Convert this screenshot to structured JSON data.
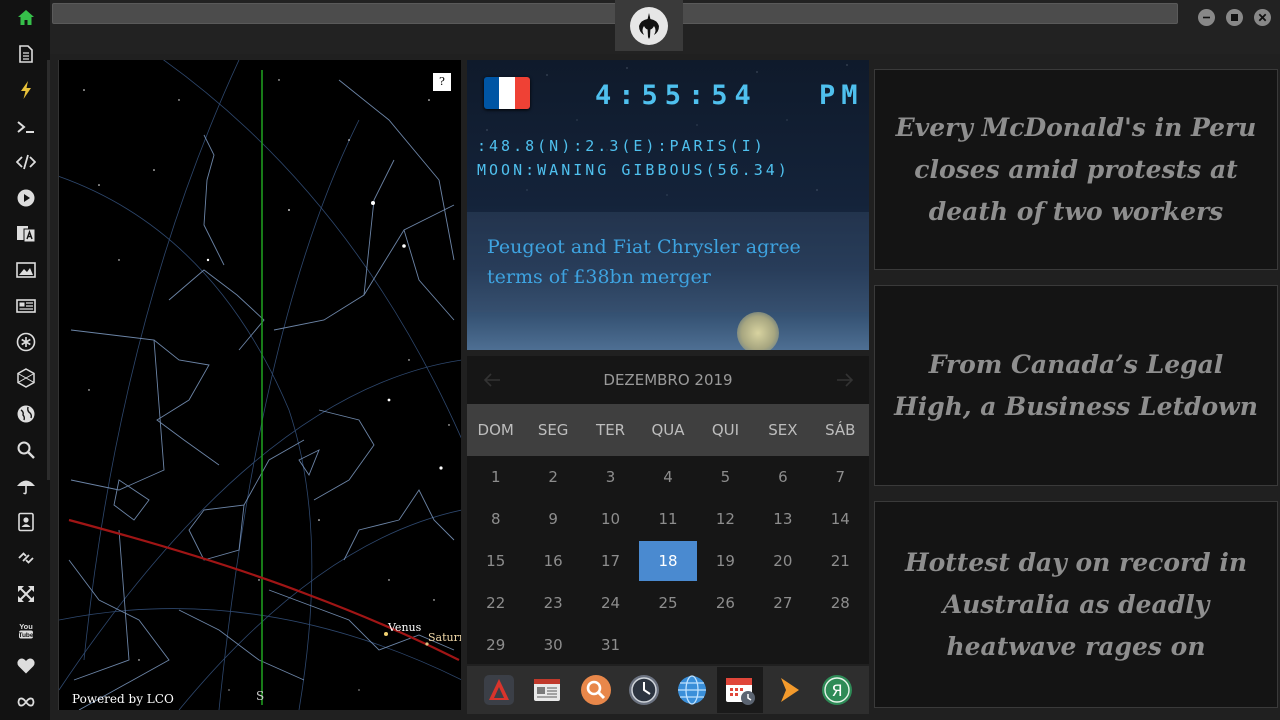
{
  "sidebar": {
    "items": [
      {
        "icon": "home-icon",
        "color": "#36c04a"
      },
      {
        "icon": "document-icon"
      },
      {
        "icon": "lightning-icon",
        "color": "#e8c23a"
      },
      {
        "icon": "terminal-icon"
      },
      {
        "icon": "code-icon"
      },
      {
        "icon": "play-icon"
      },
      {
        "icon": "translate-icon"
      },
      {
        "icon": "image-icon"
      },
      {
        "icon": "newspaper-icon"
      },
      {
        "icon": "asterisk-icon"
      },
      {
        "icon": "hexagon-icon"
      },
      {
        "icon": "globe-icon"
      },
      {
        "icon": "search-icon"
      },
      {
        "icon": "umbrella-icon"
      },
      {
        "icon": "contacts-icon"
      },
      {
        "icon": "link-icon"
      },
      {
        "icon": "expand-icon"
      },
      {
        "icon": "youtube-icon"
      },
      {
        "icon": "heart-icon"
      },
      {
        "icon": "infinity-icon"
      }
    ]
  },
  "window": {
    "logo": "rebel-alliance-icon",
    "buttons": [
      "minimize-icon",
      "maximize-icon",
      "close-icon"
    ]
  },
  "skymap": {
    "help_label": "?",
    "powered_by": "Powered by LCO",
    "planets": [
      "Venus",
      "Saturn"
    ],
    "compass_label": "S"
  },
  "clock": {
    "flag_colors": [
      "#0055a4",
      "#ffffff",
      "#ef4135"
    ],
    "time": "4:55:54",
    "ampm": "PM",
    "coords": ":48.8(N):2.3(E):PARIS(I)",
    "moon": "MOON:WANING GIBBOUS(56.34)",
    "headline": "Peugeot and Fiat Chrysler agree terms of £38bn merger"
  },
  "calendar": {
    "month": "DEZEMBRO 2019",
    "weekdays": [
      "DOM",
      "SEG",
      "TER",
      "QUA",
      "QUI",
      "SEX",
      "SÁB"
    ],
    "days": [
      "1",
      "2",
      "3",
      "4",
      "5",
      "6",
      "7",
      "8",
      "9",
      "10",
      "11",
      "12",
      "13",
      "14",
      "15",
      "16",
      "17",
      "18",
      "19",
      "20",
      "21",
      "22",
      "23",
      "24",
      "25",
      "26",
      "27",
      "28",
      "29",
      "30",
      "31"
    ],
    "today": "18"
  },
  "dock": {
    "items": [
      "app-launcher-icon",
      "news-reader-icon",
      "magnifier-app-icon",
      "clock-app-icon",
      "web-browser-icon",
      "calendar-app-icon",
      "play-arrow-icon",
      "yandex-icon"
    ],
    "active": "calendar-app-icon"
  },
  "news_cards": [
    "Every McDonald's in Peru closes amid protests at death of two workers",
    "From Canada’s Legal High, a Business Letdown",
    "Hottest day on record in Australia as deadly heatwave rages on"
  ]
}
